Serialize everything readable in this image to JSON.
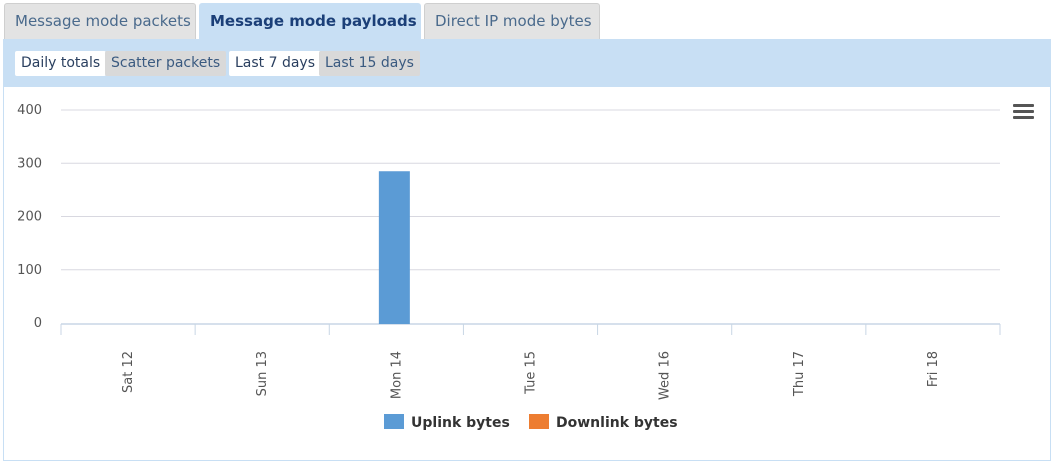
{
  "tabs": [
    {
      "label": "Message mode packets",
      "active": false
    },
    {
      "label": "Message mode payloads",
      "active": true
    },
    {
      "label": "Direct IP mode bytes",
      "active": false
    }
  ],
  "toolbar": {
    "view_buttons": [
      "Daily totals",
      "Scatter packets"
    ],
    "range_buttons": [
      "Last 7 days",
      "Last 15 days"
    ],
    "selected_view": "Daily totals",
    "selected_range": "Last 7 days"
  },
  "chart_data": {
    "type": "bar",
    "categories": [
      "Sat 12",
      "Sun 13",
      "Mon 14",
      "Tue 15",
      "Wed 16",
      "Thu 17",
      "Fri 18"
    ],
    "series": [
      {
        "name": "Uplink bytes",
        "color": "#5b9bd5",
        "values": [
          0,
          0,
          285,
          0,
          0,
          0,
          0
        ]
      },
      {
        "name": "Downlink bytes",
        "color": "#ed7d31",
        "values": [
          0,
          0,
          0,
          0,
          0,
          0,
          0
        ]
      }
    ],
    "ylim": [
      0,
      400
    ],
    "yticks": [
      0,
      100,
      200,
      300,
      400
    ],
    "grid": true,
    "legend": "bottom-center"
  },
  "menu_icon": "hamburger-menu-icon"
}
